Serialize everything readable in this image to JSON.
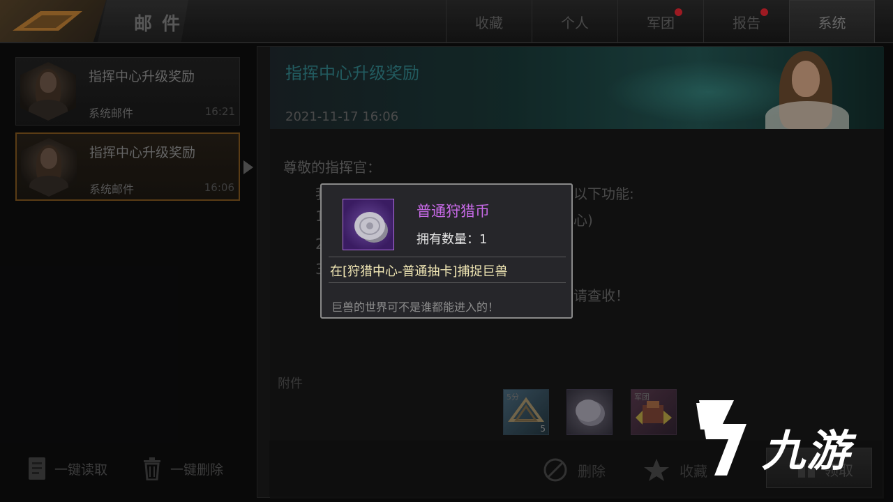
{
  "header": {
    "title": "邮件",
    "tabs": [
      {
        "label": "收藏",
        "badge": false
      },
      {
        "label": "个人",
        "badge": false
      },
      {
        "label": "军团",
        "badge": true
      },
      {
        "label": "报告",
        "badge": true
      },
      {
        "label": "系统",
        "badge": false,
        "active": true
      }
    ]
  },
  "mail_list": [
    {
      "subject": "指挥中心升级奖励",
      "sender": "系统邮件",
      "time": "16:21",
      "selected": false
    },
    {
      "subject": "指挥中心升级奖励",
      "sender": "系统邮件",
      "time": "16:06",
      "selected": true
    }
  ],
  "list_actions": {
    "read_all": "一键读取",
    "delete_all": "一键删除"
  },
  "detail": {
    "title": "指挥中心升级奖励",
    "date": "2021-11-17  16:06",
    "greeting": "尊敬的指挥官：",
    "visible_fragments": [
      "我",
      "以下功能:",
      "1",
      "心)",
      "2",
      "3",
      "请查收！"
    ],
    "attachments_label": "附件",
    "attachments": [
      {
        "tag": "5分",
        "count": "5"
      },
      {
        "tag": "",
        "count": ""
      },
      {
        "tag": "军团",
        "count": ""
      }
    ],
    "actions": {
      "delete": "删除",
      "favorite": "收藏",
      "receive": "领取"
    }
  },
  "tooltip": {
    "item_name": "普通狩猎币",
    "owned_label": "拥有数量：1",
    "source": "在[狩猎中心-普通抽卡]捕捉巨兽",
    "description": "巨兽的世界可不是谁都能进入的！"
  },
  "watermark": {
    "text": "九游"
  },
  "colors": {
    "accent_orange": "#6e4a1a",
    "badge_red": "#c0202a",
    "item_purple": "#c86ae8",
    "source_text": "#f0e6b4"
  }
}
